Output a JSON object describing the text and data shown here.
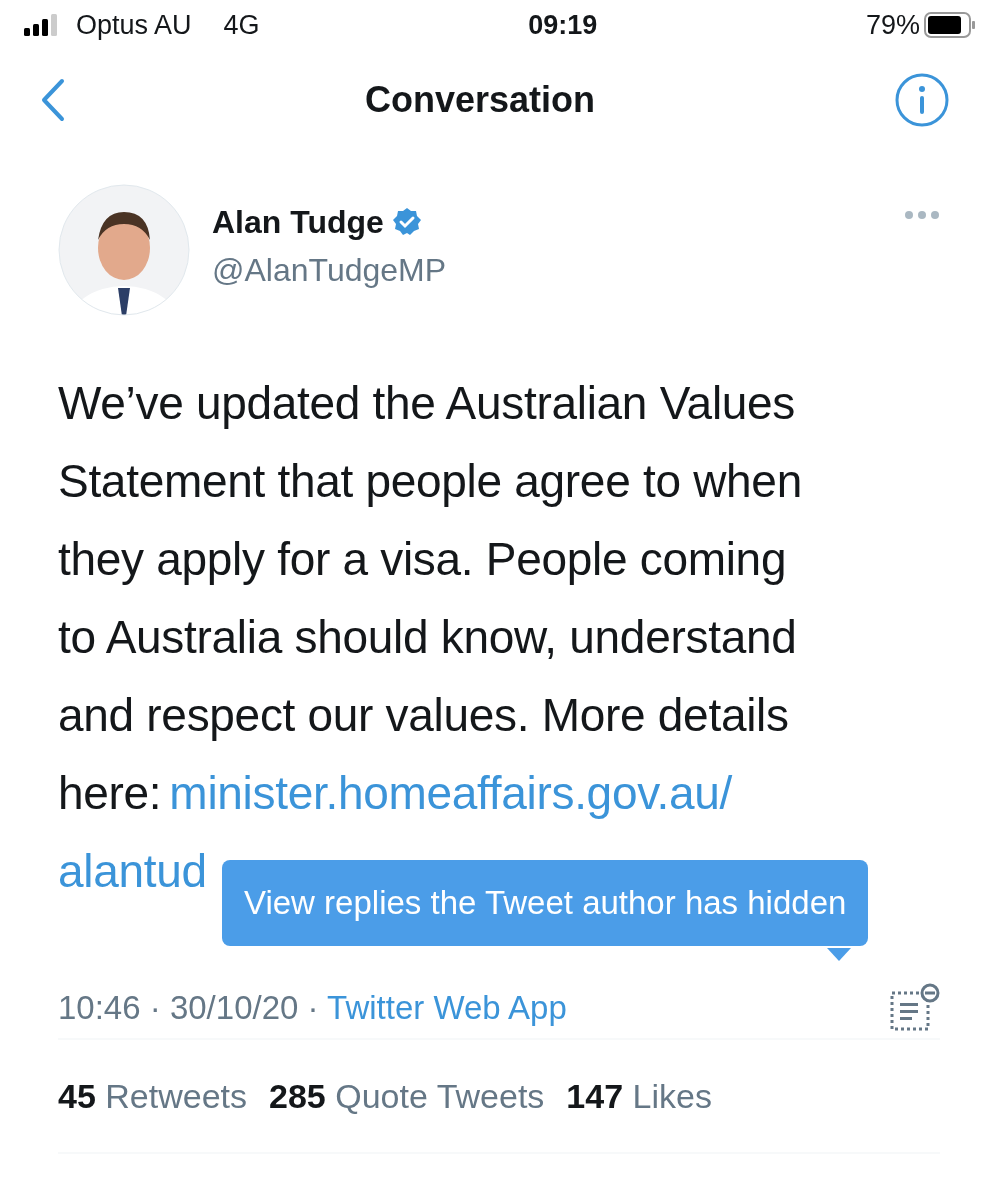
{
  "status_bar": {
    "carrier": "Optus AU",
    "network": "4G",
    "time": "09:19",
    "battery": "79%"
  },
  "nav": {
    "title": "Conversation"
  },
  "tweet": {
    "author": {
      "name": "Alan Tudge",
      "verified": true,
      "handle": "@AlanTudgeMP"
    },
    "text_lines": [
      "We’ve updated the Australian Values",
      "Statement that people agree to when",
      "they apply for a visa. People coming",
      "to Australia should know, understand",
      "and respect our values. More details",
      "here:"
    ],
    "link_lines": [
      "minister.homeaffairs.gov.au/",
      "alantud"
    ],
    "tooltip": "View replies the Tweet author has hidden",
    "timestamp": "10:46 · 30/10/20 ·",
    "source": "Twitter Web App"
  },
  "stats": [
    {
      "count": "45",
      "label": "Retweets"
    },
    {
      "count": "285",
      "label": "Quote Tweets"
    },
    {
      "count": "147",
      "label": "Likes"
    }
  ]
}
